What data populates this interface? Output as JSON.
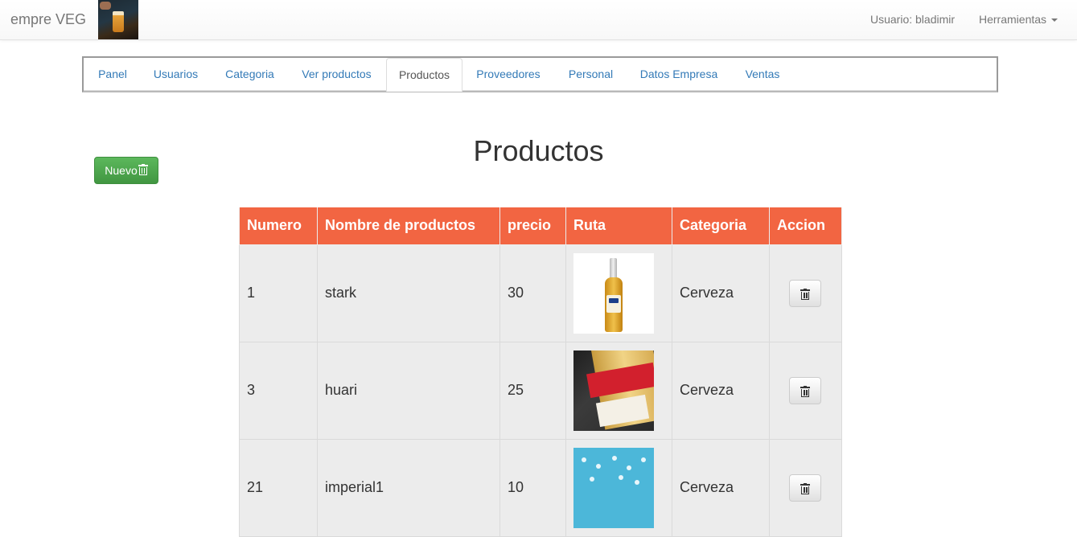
{
  "navbar": {
    "brand": "empre VEG",
    "user_label": "Usuario: bladimir",
    "tools_label": "Herramientas"
  },
  "tabs": [
    {
      "label": "Panel",
      "active": false
    },
    {
      "label": "Usuarios",
      "active": false
    },
    {
      "label": "Categoria",
      "active": false
    },
    {
      "label": "Ver productos",
      "active": false
    },
    {
      "label": "Productos",
      "active": true
    },
    {
      "label": "Proveedores",
      "active": false
    },
    {
      "label": "Personal",
      "active": false
    },
    {
      "label": "Datos Empresa",
      "active": false
    },
    {
      "label": "Ventas",
      "active": false
    }
  ],
  "page": {
    "title": "Productos",
    "new_button_label": "Nuevo"
  },
  "table": {
    "headers": [
      "Numero",
      "Nombre de productos",
      "precio",
      "Ruta",
      "Categoria",
      "Accion"
    ],
    "rows": [
      {
        "numero": "1",
        "nombre": "stark",
        "precio": "30",
        "image": "corona-bottle",
        "categoria": "Cerveza"
      },
      {
        "numero": "3",
        "nombre": "huari",
        "precio": "25",
        "image": "huari-can",
        "categoria": "Cerveza"
      },
      {
        "numero": "21",
        "nombre": "imperial1",
        "precio": "10",
        "image": "imperial-icons",
        "categoria": "Cerveza"
      }
    ]
  },
  "colors": {
    "table_header": "#f26542",
    "row_bg": "#ececec",
    "nuevo_button": "#4cae4c",
    "tab_link": "#337ab7"
  }
}
